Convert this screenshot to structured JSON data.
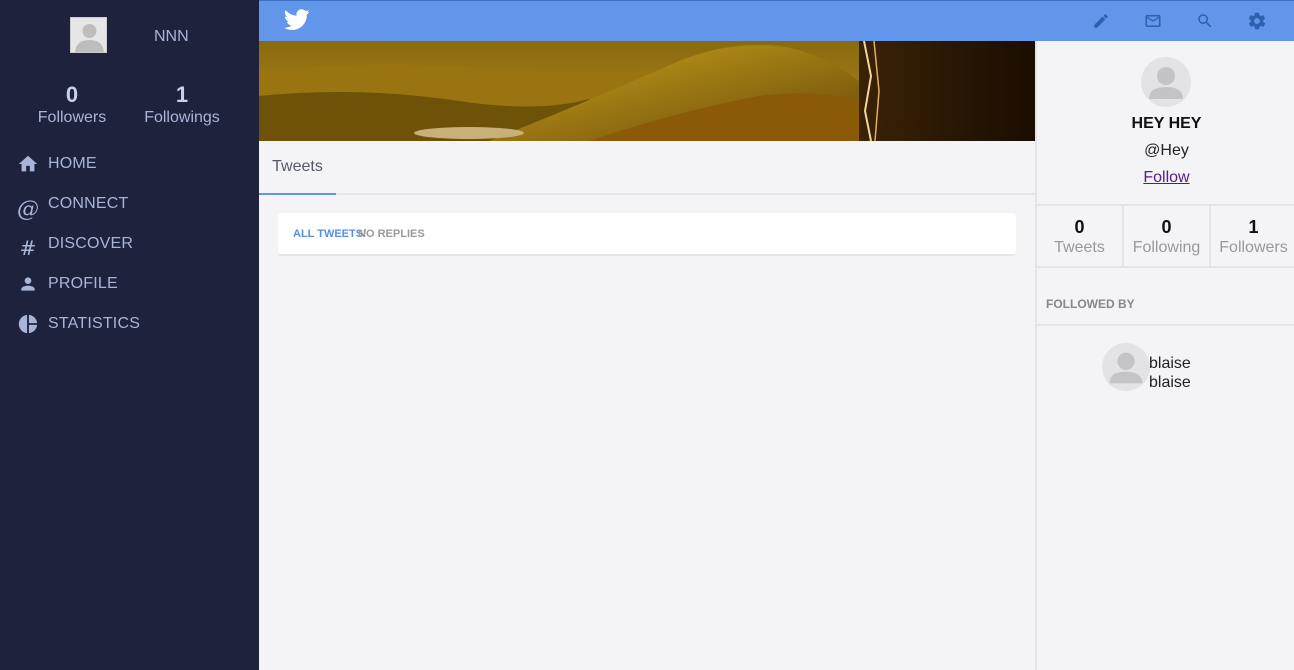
{
  "sidebar": {
    "username": "NNN",
    "followers_count": "0",
    "followers_label": "Followers",
    "followings_count": "1",
    "followings_label": "Followings",
    "nav": [
      {
        "label": "HOME",
        "icon": "home-icon"
      },
      {
        "label": "CONNECT",
        "icon": "at-icon"
      },
      {
        "label": "DISCOVER",
        "icon": "hash-icon"
      },
      {
        "label": "PROFILE",
        "icon": "person-icon"
      },
      {
        "label": "STATISTICS",
        "icon": "pie-chart-icon"
      }
    ]
  },
  "topbar": {
    "logo": "twitter-bird-icon",
    "icons": [
      "compose-icon",
      "mail-icon",
      "search-icon",
      "settings-icon"
    ],
    "color": "#6196ea"
  },
  "main": {
    "tab_label": "Tweets",
    "filter_all": "ALL TWEETS/",
    "filter_no_replies": " NO REPLIES"
  },
  "profile": {
    "name": "HEY HEY",
    "handle": "@Hey",
    "follow_label": "Follow",
    "stats": [
      {
        "count": "0",
        "label": "Tweets"
      },
      {
        "count": "0",
        "label": "Following"
      },
      {
        "count": "1",
        "label": "Followers"
      }
    ],
    "followed_by_title": "FOLLOWED BY",
    "followed_by": [
      {
        "line1": "blaise",
        "line2": "blaise"
      }
    ]
  },
  "colors": {
    "sidebar_bg": "#1e223d",
    "accent": "#6196ea",
    "link_visited": "#551a8b"
  }
}
